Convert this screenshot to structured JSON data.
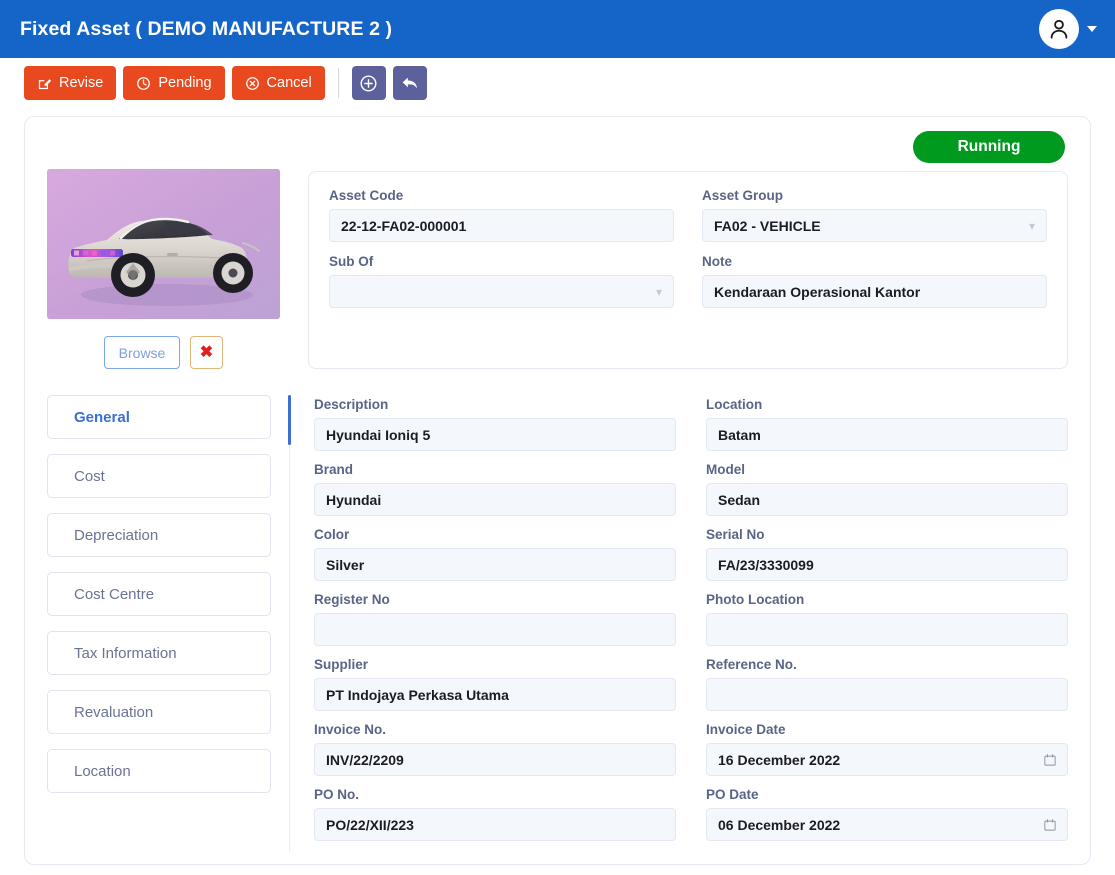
{
  "header": {
    "title": "Fixed Asset ( DEMO MANUFACTURE 2 )",
    "avatar_icon": "user-icon",
    "caret_icon": "chevron-down-icon",
    "background_color": "#1565c9"
  },
  "toolbar": {
    "buttons": [
      {
        "label": "Revise",
        "icon": "edit-square-icon",
        "color": "#e8491e"
      },
      {
        "label": "Pending",
        "icon": "clock-icon",
        "color": "#e8491e"
      },
      {
        "label": "Cancel",
        "icon": "x-circle-icon",
        "color": "#e8491e"
      }
    ],
    "icon_buttons": [
      {
        "name": "add-button",
        "icon": "plus-circle-icon",
        "color": "#5c619c"
      },
      {
        "name": "back-button",
        "icon": "reply-arrow-icon",
        "color": "#5c619c"
      }
    ]
  },
  "status": {
    "label": "Running",
    "color": "#009a1e"
  },
  "photo": {
    "alt": "Hyundai Ioniq 5 silver car on purple background",
    "browse_label": "Browse",
    "remove_label": "✖"
  },
  "asset_info": {
    "asset_code": {
      "label": "Asset Code",
      "value": "22-12-FA02-000001"
    },
    "asset_group": {
      "label": "Asset Group",
      "value": "FA02 - VEHICLE"
    },
    "sub_of": {
      "label": "Sub Of",
      "value": ""
    },
    "note": {
      "label": "Note",
      "value": "Kendaraan Operasional Kantor"
    }
  },
  "tabs": [
    {
      "label": "General",
      "active": true
    },
    {
      "label": "Cost",
      "active": false
    },
    {
      "label": "Depreciation",
      "active": false
    },
    {
      "label": "Cost Centre",
      "active": false
    },
    {
      "label": "Tax Information",
      "active": false
    },
    {
      "label": "Revaluation",
      "active": false
    },
    {
      "label": "Location",
      "active": false
    }
  ],
  "general_form": {
    "description": {
      "label": "Description",
      "value": "Hyundai Ioniq 5"
    },
    "location": {
      "label": "Location",
      "value": "Batam"
    },
    "brand": {
      "label": "Brand",
      "value": "Hyundai"
    },
    "model": {
      "label": "Model",
      "value": "Sedan"
    },
    "color": {
      "label": "Color",
      "value": "Silver"
    },
    "serial_no": {
      "label": "Serial No",
      "value": "FA/23/3330099"
    },
    "register_no": {
      "label": "Register No",
      "value": ""
    },
    "photo_location": {
      "label": "Photo Location",
      "value": ""
    },
    "supplier": {
      "label": "Supplier",
      "value": "PT Indojaya Perkasa Utama"
    },
    "reference_no": {
      "label": "Reference No.",
      "value": ""
    },
    "invoice_no": {
      "label": "Invoice No.",
      "value": "INV/22/2209"
    },
    "invoice_date": {
      "label": "Invoice Date",
      "value": "16 December 2022",
      "icon": "calendar-icon"
    },
    "po_no": {
      "label": "PO No.",
      "value": "PO/22/XII/223"
    },
    "po_date": {
      "label": "PO Date",
      "value": "06 December 2022",
      "icon": "calendar-icon"
    }
  }
}
